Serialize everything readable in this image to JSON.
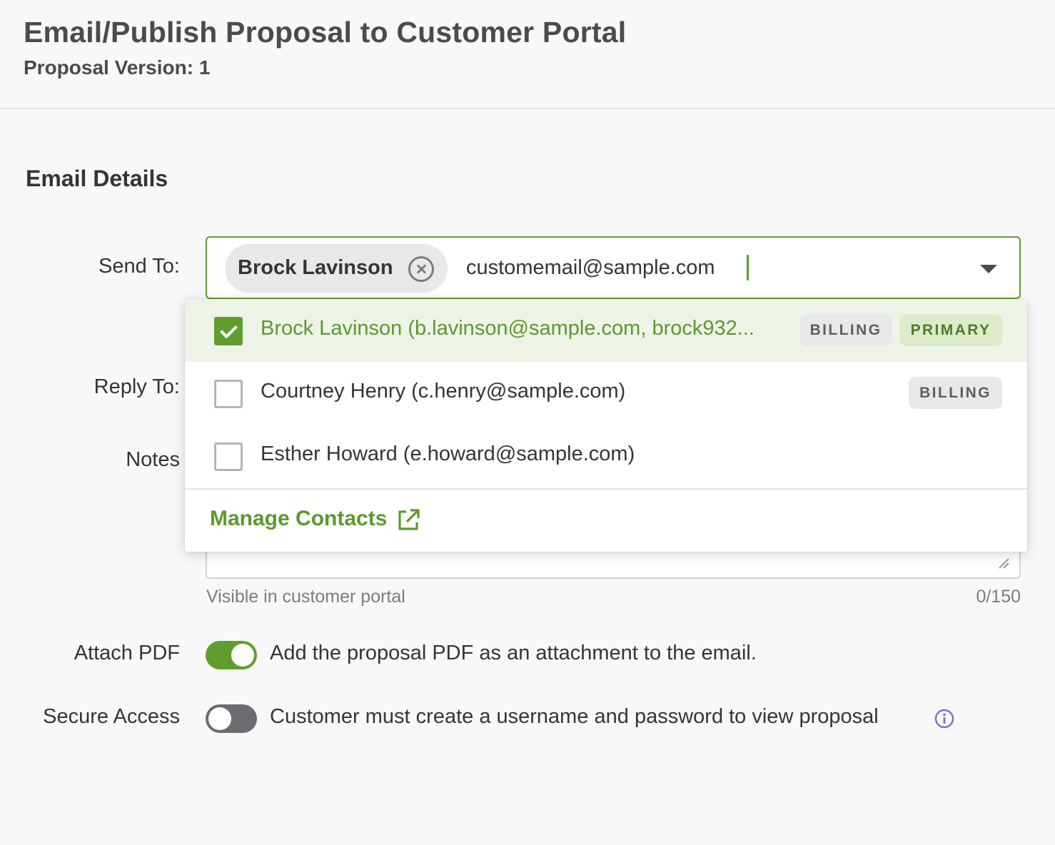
{
  "header": {
    "title": "Email/Publish Proposal to Customer Portal",
    "subtitle": "Proposal Version: 1"
  },
  "section_title": "Email Details",
  "labels": {
    "send_to": "Send To:",
    "reply_to": "Reply To:",
    "notes": "Notes",
    "attach_pdf": "Attach PDF",
    "secure_access": "Secure Access"
  },
  "send_to": {
    "chip_label": "Brock Lavinson",
    "typed_value": "customemail@sample.com"
  },
  "contacts_menu": {
    "items": [
      {
        "label": "Brock Lavinson (b.lavinson@sample.com, brock932...",
        "checked": true,
        "tags": [
          "BILLING",
          "PRIMARY"
        ]
      },
      {
        "label": "Courtney Henry  (c.henry@sample.com)",
        "checked": false,
        "tags": [
          "BILLING"
        ]
      },
      {
        "label": "Esther Howard (e.howard@sample.com)",
        "checked": false,
        "tags": []
      }
    ],
    "manage_link": "Manage Contacts"
  },
  "notes": {
    "hint": "Visible in customer portal",
    "counter": "0/150"
  },
  "attach_pdf": {
    "enabled": true,
    "description": "Add the proposal PDF as an attachment to the email."
  },
  "secure_access": {
    "enabled": false,
    "description": "Customer must create a username and password to view proposal"
  },
  "colors": {
    "accent": "#5f9e2e",
    "selected_row_bg": "#eef3e8",
    "primary_tag_bg": "#dcecc9",
    "info_icon": "#7a6fd6"
  }
}
